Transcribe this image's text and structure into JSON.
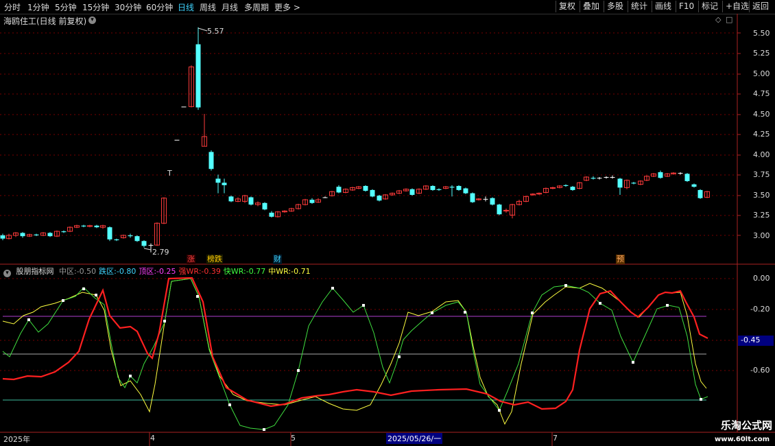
{
  "toolbar": {
    "periods": [
      "分时",
      "1分钟",
      "5分钟",
      "15分钟",
      "30分钟",
      "60分钟",
      "日线",
      "周线",
      "月线",
      "多周期",
      "更多 >"
    ],
    "active_period": "日线",
    "right_buttons": [
      "复权",
      "叠加",
      "多股",
      "统计",
      "画线",
      "F10",
      "标记",
      "+自选",
      "返回"
    ]
  },
  "chart_title": "海鸥住工(日线 前复权)",
  "price_axis": [
    "5.50",
    "5.25",
    "5.00",
    "4.75",
    "4.50",
    "4.25",
    "4.00",
    "3.75",
    "3.50",
    "3.25",
    "3.00"
  ],
  "high_label": "5.57",
  "low_label": "2.79",
  "marker_t": "T",
  "events": [
    {
      "text": "涨",
      "color": "#c03030"
    },
    {
      "text": "榜跌",
      "color": "#ffcc00"
    },
    {
      "text": "财",
      "color": "#3fd5ff"
    },
    {
      "text": "预",
      "color": "#d07020"
    }
  ],
  "indicator": {
    "name": "股朋指标网",
    "items": [
      {
        "label": "中区:",
        "value": "-0.50",
        "color": "#999999"
      },
      {
        "label": "跌区:",
        "value": "-0.80",
        "color": "#3fd5ff"
      },
      {
        "label": "顶区:",
        "value": "-0.25",
        "color": "#ff40ff"
      },
      {
        "label": "强WR:",
        "value": "-0.39",
        "color": "#ff3030"
      },
      {
        "label": "快WR:",
        "value": "-0.77",
        "color": "#40ff40"
      },
      {
        "label": "中WR:",
        "value": "-0.71",
        "color": "#ffff40"
      }
    ],
    "axis": [
      "0.00",
      "-0.20",
      "-0.40",
      "-0.60"
    ],
    "current_value": "-0.45"
  },
  "date_axis": [
    "2025年",
    "4",
    "5",
    "2025/05/26/一",
    "7"
  ],
  "watermark": {
    "title": "乐淘公式网",
    "url": "www.60lt.com"
  },
  "colors": {
    "up": "#ff3b3b",
    "down": "#54ffff",
    "grid": "#8b0000"
  }
}
